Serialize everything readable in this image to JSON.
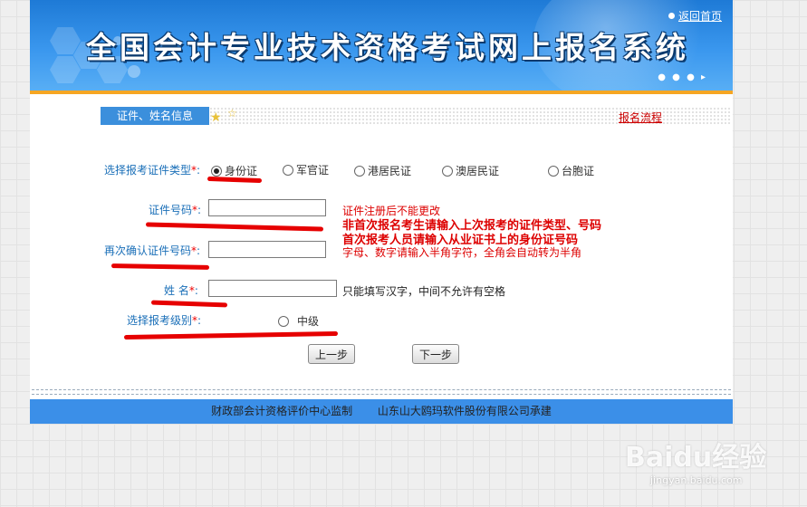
{
  "header": {
    "title": "全国会计专业技术资格考试网上报名系统",
    "home_link": "返回首页"
  },
  "section": {
    "tab_label": "证件、姓名信息",
    "flow_link": "报名流程"
  },
  "form": {
    "id_type_label": "选择报考证件类型",
    "id_types": [
      "身份证",
      "军官证",
      "港居民证",
      "澳居民证",
      "台胞证"
    ],
    "id_type_selected": "身份证",
    "id_number_label": "证件号码",
    "id_number_value": "",
    "id_confirm_label": "再次确认证件号码",
    "id_confirm_value": "",
    "name_label": "姓 名",
    "name_value": "",
    "level_label": "选择报考级别",
    "level_option": "中级",
    "required_mark": "*",
    "colon": ":"
  },
  "notes": {
    "no_change": "证件注册后不能更改",
    "repeat_line1": "非首次报名考生请输入上次报考的证件类型、号码",
    "repeat_line2": "首次报考人员请输入从业证书上的身份证号码",
    "halfwidth": "字母、数字请输入半角字符，全角会自动转为半角",
    "name_rule": "只能填写汉字，中间不允许有空格"
  },
  "buttons": {
    "prev": "上一步",
    "next": "下一步"
  },
  "footer": {
    "supervisor": "财政部会计资格评价中心监制",
    "builder": "山东山大鸥玛软件股份有限公司承建"
  },
  "watermark": {
    "logo": "Baidu经验",
    "url": "jingyan.baidu.com"
  },
  "colors": {
    "banner_blue": "#2f8ae6",
    "accent_orange": "#f5a623",
    "label_blue": "#1a6fb8",
    "alert_red": "#dd0000",
    "annotation_red": "#e60000"
  }
}
